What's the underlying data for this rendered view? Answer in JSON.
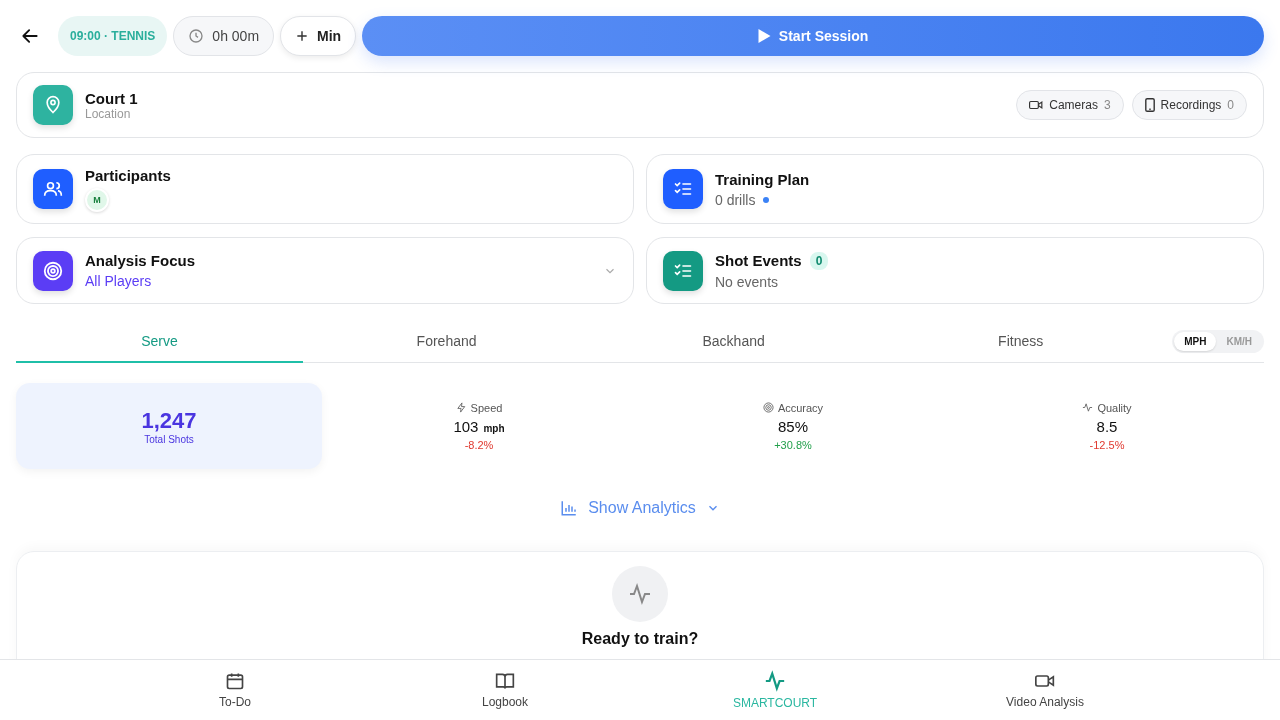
{
  "header": {
    "session_tag": "09:00 · TENNIS",
    "timer": "0h 00m",
    "add_button": "Min",
    "start_button": "Start Session"
  },
  "location": {
    "title": "Court 1",
    "subtitle": "Location",
    "chips": [
      {
        "kind": "camera",
        "label": "Cameras",
        "count": "3"
      },
      {
        "kind": "phone",
        "label": "Recordings",
        "count": "0"
      }
    ]
  },
  "cards": [
    {
      "kind": "participants",
      "title": "Participants",
      "avatars": [
        "M"
      ]
    },
    {
      "kind": "plan",
      "title": "Training Plan",
      "subtitle": "0 drills"
    },
    {
      "kind": "focus",
      "title": "Analysis Focus",
      "subtitle": "All Players"
    },
    {
      "kind": "events",
      "title": "Shot Events",
      "badge": "0",
      "subtitle": "No events"
    }
  ],
  "tabs": [
    {
      "label": "Serve",
      "selected": true
    },
    {
      "label": "Forehand",
      "selected": false
    },
    {
      "label": "Backhand",
      "selected": false
    },
    {
      "label": "Fitness",
      "selected": false
    }
  ],
  "units": [
    {
      "label": "MPH",
      "selected": true
    },
    {
      "label": "KM/H",
      "selected": false
    }
  ],
  "total": {
    "value": "1,247",
    "label": "Total Shots"
  },
  "stats": [
    {
      "kind": "speed",
      "label": "Speed",
      "value": "103",
      "unit": "mph",
      "delta": "-8.2%",
      "color": "#e0392f"
    },
    {
      "kind": "accuracy",
      "label": "Accuracy",
      "value": "85%",
      "delta": "+30.8%",
      "color": "#22a04b"
    },
    {
      "kind": "quality",
      "label": "Quality",
      "value": "8.5",
      "delta": "-12.5%",
      "color": "#e0392f"
    }
  ],
  "analytics_toggle": "Show Analytics",
  "empty_state": {
    "title": "Ready to train?"
  },
  "nav": [
    {
      "kind": "calendar",
      "label": "To-Do",
      "selected": false
    },
    {
      "kind": "book",
      "label": "Logbook",
      "selected": false
    },
    {
      "kind": "pulse",
      "label": "SMARTCOURT",
      "selected": true
    },
    {
      "kind": "video",
      "label": "Video Analysis",
      "selected": false
    }
  ]
}
